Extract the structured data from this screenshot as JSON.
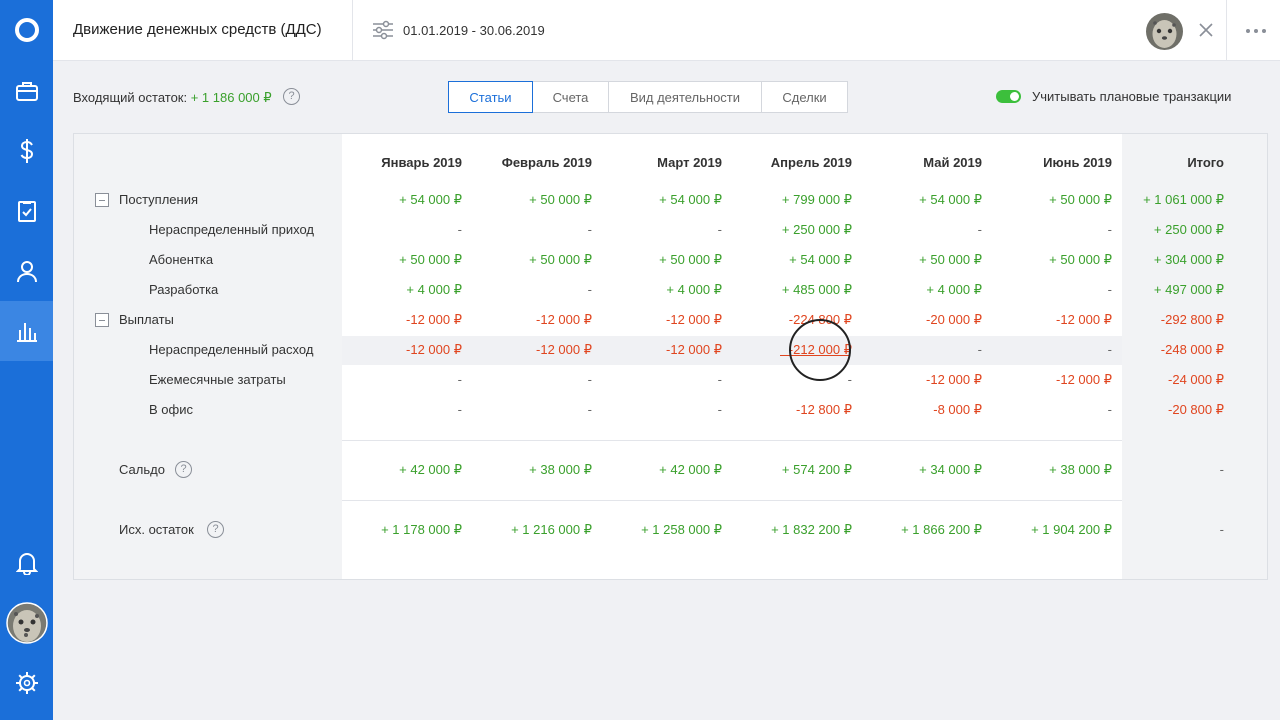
{
  "header": {
    "title": "Движение денежных средств (ДДС)",
    "date_range": "01.01.2019 - 30.06.2019"
  },
  "toolbar": {
    "opening_label": "Входящий остаток: ",
    "opening_value": "+ 1 186 000 ₽",
    "help": "?",
    "tabs": [
      "Статьи",
      "Счета",
      "Вид деятельности",
      "Сделки"
    ],
    "toggle_label": "Учитывать плановые транзакции",
    "toggle_on": true
  },
  "table": {
    "columns": [
      "Январь 2019",
      "Февраль 2019",
      "Март 2019",
      "Апрель 2019",
      "Май 2019",
      "Июнь 2019",
      "Итого"
    ],
    "rows": [
      {
        "label": "Поступления",
        "kind": "group",
        "cells": [
          "+ 54 000 ₽",
          "+ 50 000 ₽",
          "+ 54 000 ₽",
          "+ 799 000 ₽",
          "+ 54 000 ₽",
          "+ 50 000 ₽",
          "+ 1 061 000 ₽"
        ]
      },
      {
        "label": "Нераспределенный приход",
        "kind": "sub",
        "cells": [
          "-",
          "-",
          "-",
          "+ 250 000 ₽",
          "-",
          "-",
          "+ 250 000 ₽"
        ]
      },
      {
        "label": "Абонентка",
        "kind": "sub",
        "cells": [
          "+ 50 000 ₽",
          "+ 50 000 ₽",
          "+ 50 000 ₽",
          "+ 54 000 ₽",
          "+ 50 000 ₽",
          "+ 50 000 ₽",
          "+ 304 000 ₽"
        ]
      },
      {
        "label": "Разработка",
        "kind": "sub",
        "cells": [
          "+ 4 000 ₽",
          "-",
          "+ 4 000 ₽",
          "+ 485 000 ₽",
          "+ 4 000 ₽",
          "-",
          "+ 497 000 ₽"
        ]
      },
      {
        "label": "Выплаты",
        "kind": "group",
        "cells": [
          "-12 000 ₽",
          "-12 000 ₽",
          "-12 000 ₽",
          "-224 800 ₽",
          "-20 000 ₽",
          "-12 000 ₽",
          "-292 800 ₽"
        ]
      },
      {
        "label": "Нераспределенный расход",
        "kind": "sub",
        "cells": [
          "-12 000 ₽",
          "-12 000 ₽",
          "-12 000 ₽",
          "-212 000 ₽",
          "-",
          "-",
          "-248 000 ₽"
        ]
      },
      {
        "label": "Ежемесячные затраты",
        "kind": "sub",
        "cells": [
          "-",
          "-",
          "-",
          "-",
          "-12 000 ₽",
          "-12 000 ₽",
          "-24 000 ₽"
        ]
      },
      {
        "label": "В офис",
        "kind": "sub",
        "cells": [
          "-",
          "-",
          "-",
          "-12 800 ₽",
          "-8 000 ₽",
          "-",
          "-20 800 ₽"
        ]
      }
    ],
    "balance": {
      "label": "Сальдо",
      "cells": [
        "+ 42 000 ₽",
        "+ 38 000 ₽",
        "+ 42 000 ₽",
        "+ 574 200 ₽",
        "+ 34 000 ₽",
        "+ 38 000 ₽",
        "-"
      ]
    },
    "closing": {
      "label": "Исх. остаток",
      "cells": [
        "+ 1 178 000 ₽",
        "+ 1 216 000 ₽",
        "+ 1 258 000 ₽",
        "+ 1 832 200 ₽",
        "+ 1 866 200 ₽",
        "+ 1 904 200 ₽",
        "-"
      ]
    }
  },
  "colors": {
    "sidebar": "#1b6fd9",
    "positive": "#3aa02c",
    "negative": "#e0451f",
    "toggle": "#3cbf3c"
  }
}
